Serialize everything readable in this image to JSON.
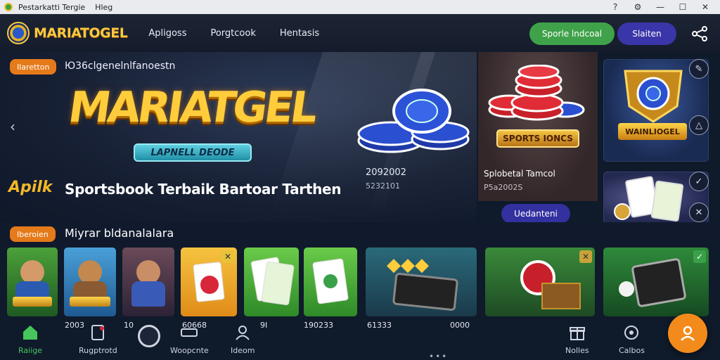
{
  "titlebar": {
    "title": "Pestarkatti Tergie",
    "menu": "Hleg"
  },
  "header": {
    "brand": "MARIATOGEL",
    "nav": [
      "Apligoss",
      "Porgtcook",
      "Hentasis"
    ],
    "btn_primary": "Sporle lndcoal",
    "btn_secondary": "Slaiten"
  },
  "hero": {
    "tag": "Ilaretton",
    "topline": "Ю36clgenelnlfanoestn",
    "big_title": "MARIATGEL",
    "pill": "LAPNELL DEODE",
    "apk": "Apilk",
    "headline": "Sportsbook Terbaik Bartoar Tarthen",
    "stat_main": "2092002",
    "stat_sub": "5232101"
  },
  "sports_card": {
    "ribbon": "SPORTS IONCS",
    "title": "Splobetal Tamcol",
    "sub": "P5a2002S",
    "button": "Uedanteni"
  },
  "side_card": {
    "label": "WAINLIOGEL"
  },
  "section2": {
    "tag": "Iberoien",
    "label": "Miyrar bldanalalara"
  },
  "tile_stats": [
    "2003",
    "10",
    "60668",
    "9I",
    "190233",
    "61333",
    "0000"
  ],
  "bottom_nav": [
    {
      "label": "Raiige",
      "icon": "home-icon",
      "active": true
    },
    {
      "label": "Rugptrotd",
      "icon": "ticket-icon",
      "active": false
    },
    {
      "label": "Woopcnte",
      "icon": "reel-icon",
      "active": false
    },
    {
      "label": "Ideom",
      "icon": "user-icon",
      "active": false
    },
    {
      "label": "Nolles",
      "icon": "gift-icon",
      "active": false
    },
    {
      "label": "Calbos",
      "icon": "settings-icon",
      "active": false
    }
  ],
  "colors": {
    "accent_green": "#3fa24a",
    "accent_purple": "#3a35a8",
    "accent_orange": "#e57a1a",
    "gold": "#ffcd3c"
  }
}
